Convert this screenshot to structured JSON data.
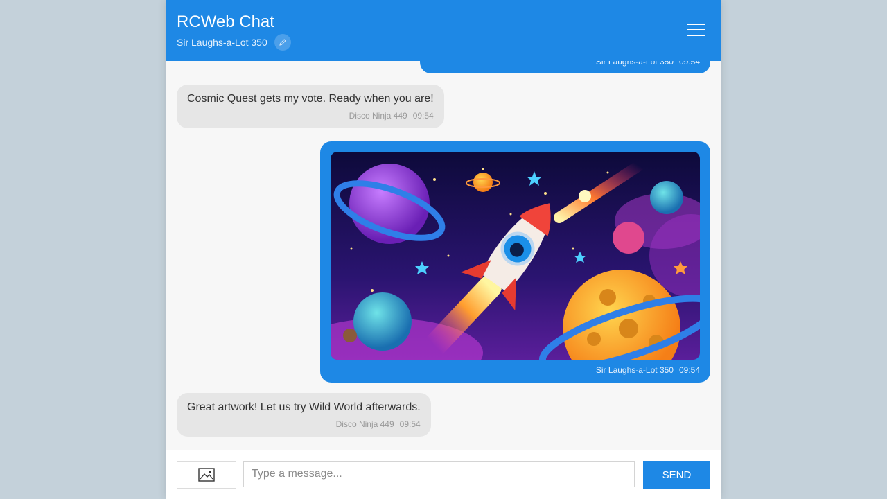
{
  "header": {
    "title": "RCWeb Chat",
    "username": "Sir Laughs-a-Lot 350",
    "edit_icon": "pencil-icon",
    "menu_icon": "hamburger-menu-icon",
    "color": "#1e88e5"
  },
  "messages": [
    {
      "mine": true,
      "author": "Sir Laughs-a-Lot 350",
      "time": "09:54"
    },
    {
      "mine": false,
      "text": "Cosmic Quest gets my vote. Ready when you are!",
      "author": "Disco Ninja 449",
      "time": "09:54"
    },
    {
      "mine": true,
      "image": "cartoon rocket in space with planets and comet",
      "author": "Sir Laughs-a-Lot 350",
      "time": "09:54"
    },
    {
      "mine": false,
      "text": "Great artwork! Let us try Wild World afterwards.",
      "author": "Disco Ninja 449",
      "time": "09:54"
    }
  ],
  "composer": {
    "image_icon": "image-upload-icon",
    "placeholder": "Type a message...",
    "value": "",
    "send_label": "SEND"
  },
  "colors": {
    "accent": "#1e88e5",
    "their_bubble": "#e6e6e6",
    "background": "#c4d1da"
  }
}
